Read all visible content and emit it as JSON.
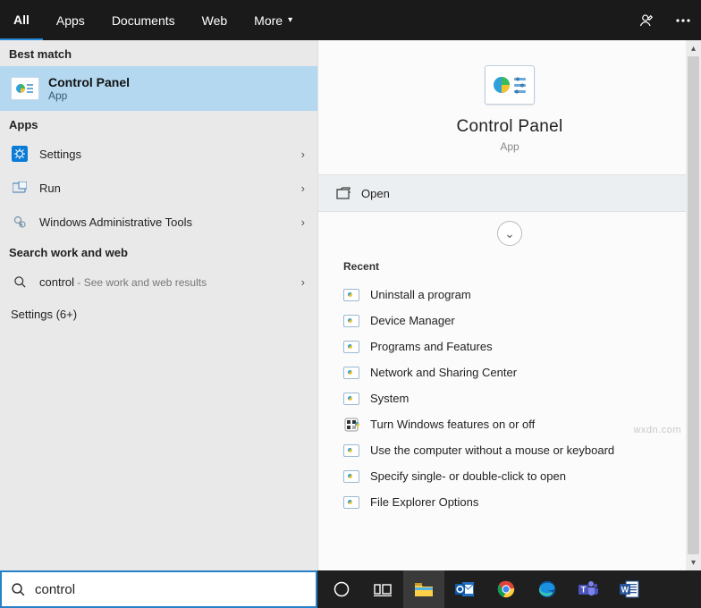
{
  "tabs": {
    "all": "All",
    "apps": "Apps",
    "documents": "Documents",
    "web": "Web",
    "more": "More"
  },
  "sections": {
    "best_match": "Best match",
    "apps": "Apps",
    "search_web": "Search work and web",
    "settings_more": "Settings (6+)"
  },
  "best_match": {
    "title": "Control Panel",
    "subtitle": "App"
  },
  "apps_list": [
    {
      "label": "Settings"
    },
    {
      "label": "Run"
    },
    {
      "label": "Windows Administrative Tools"
    }
  ],
  "web_item": {
    "query": "control",
    "hint": " - See work and web results"
  },
  "preview": {
    "title": "Control Panel",
    "subtitle": "App",
    "open": "Open",
    "recent_header": "Recent"
  },
  "recent": [
    "Uninstall a program",
    "Device Manager",
    "Programs and Features",
    "Network and Sharing Center",
    "System",
    "Turn Windows features on or off",
    "Use the computer without a mouse or keyboard",
    "Specify single- or double-click to open",
    "File Explorer Options"
  ],
  "search_value": "control",
  "watermark": "wxdn.com"
}
